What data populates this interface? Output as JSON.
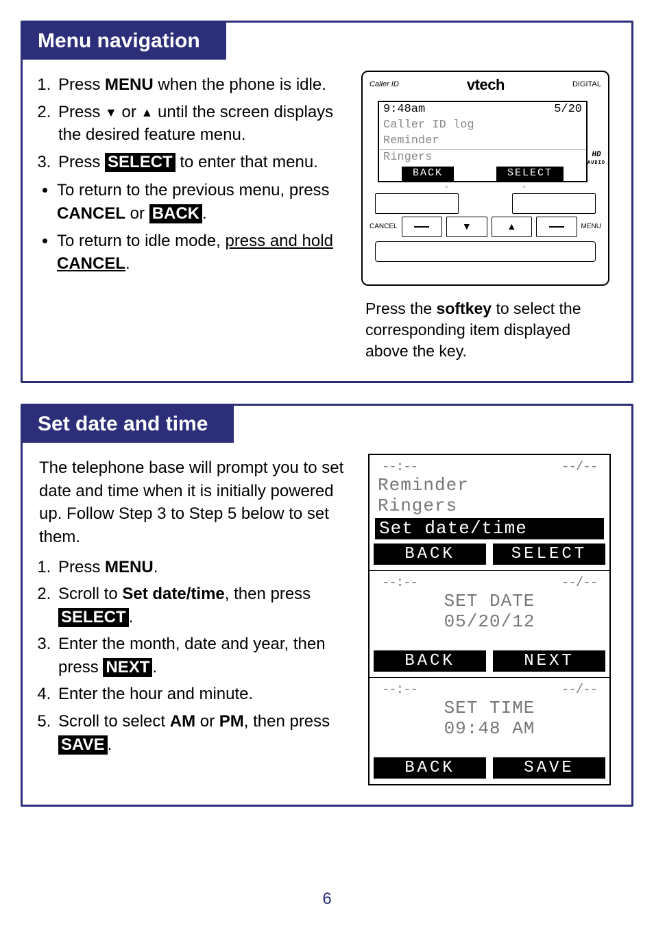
{
  "page_number": "6",
  "section1": {
    "title": "Menu navigation",
    "steps": [
      {
        "pre": "Press ",
        "bold": "MENU",
        "post": " when the phone is idle."
      },
      {
        "pre": "Press ",
        "glyph1": "▼",
        "mid": " or ",
        "glyph2": "▲",
        "post": " until the screen displays the desired feature menu."
      },
      {
        "pre": "Press ",
        "inv": "SELECT",
        "post": " to enter that menu."
      }
    ],
    "bullets": [
      {
        "pre": "To return to the previous menu, press ",
        "bold": "CANCEL",
        "mid": " or ",
        "inv": "BACK",
        "post": "."
      },
      {
        "pre": "To return to idle mode, ",
        "underline_pre": "press and hold ",
        "bold": "CANCEL",
        "post": "."
      }
    ],
    "phone": {
      "left_header": "Caller ID",
      "brand": "vtech",
      "right_header": "DIGITAL",
      "screen_time": "9:48am",
      "screen_date": "5/20",
      "line1": "Caller ID log",
      "line2": "Reminder",
      "line3": "Ringers",
      "soft_left": "BACK",
      "soft_right": "SELECT",
      "label_cancel": "CANCEL",
      "label_menu": "MENU",
      "hd": "HD",
      "hd_sub": "AUDIO"
    },
    "caption_pre": "Press the ",
    "caption_bold": "softkey",
    "caption_post": " to select the corresponding item displayed above the key."
  },
  "section2": {
    "title": "Set date and time",
    "intro": "The telephone base will prompt you to set date and time when it is initially powered up. Follow Step 3 to Step 5 below to set them.",
    "steps": {
      "s1_pre": "Press ",
      "s1_bold": "MENU",
      "s1_post": ".",
      "s2_pre": "Scroll to ",
      "s2_bold": "Set date/time",
      "s2_mid": ", then press ",
      "s2_inv": "SELECT",
      "s2_post": ".",
      "s3_pre": "Enter the month, date and year, then press ",
      "s3_inv": "NEXT",
      "s3_post": ".",
      "s4": "Enter the hour and minute.",
      "s5_pre": "Scroll to select ",
      "s5_b1": "AM",
      "s5_mid": " or ",
      "s5_b2": "PM",
      "s5_mid2": ", then press ",
      "s5_inv": "SAVE",
      "s5_post": "."
    },
    "lcd1": {
      "hint_left": "--:--",
      "hint_right": "--/--",
      "l1": "Reminder",
      "l2": "Ringers",
      "sel": "Set date/time",
      "soft_left": "BACK",
      "soft_right": "SELECT"
    },
    "lcd2": {
      "hint_left": "--:--",
      "hint_right": "--/--",
      "l1": "SET DATE",
      "l2": "05/20/12",
      "soft_left": "BACK",
      "soft_right": "NEXT"
    },
    "lcd3": {
      "hint_left": "--:--",
      "hint_right": "--/--",
      "l1": "SET TIME",
      "l2": "09:48 AM",
      "soft_left": "BACK",
      "soft_right": "SAVE"
    }
  }
}
